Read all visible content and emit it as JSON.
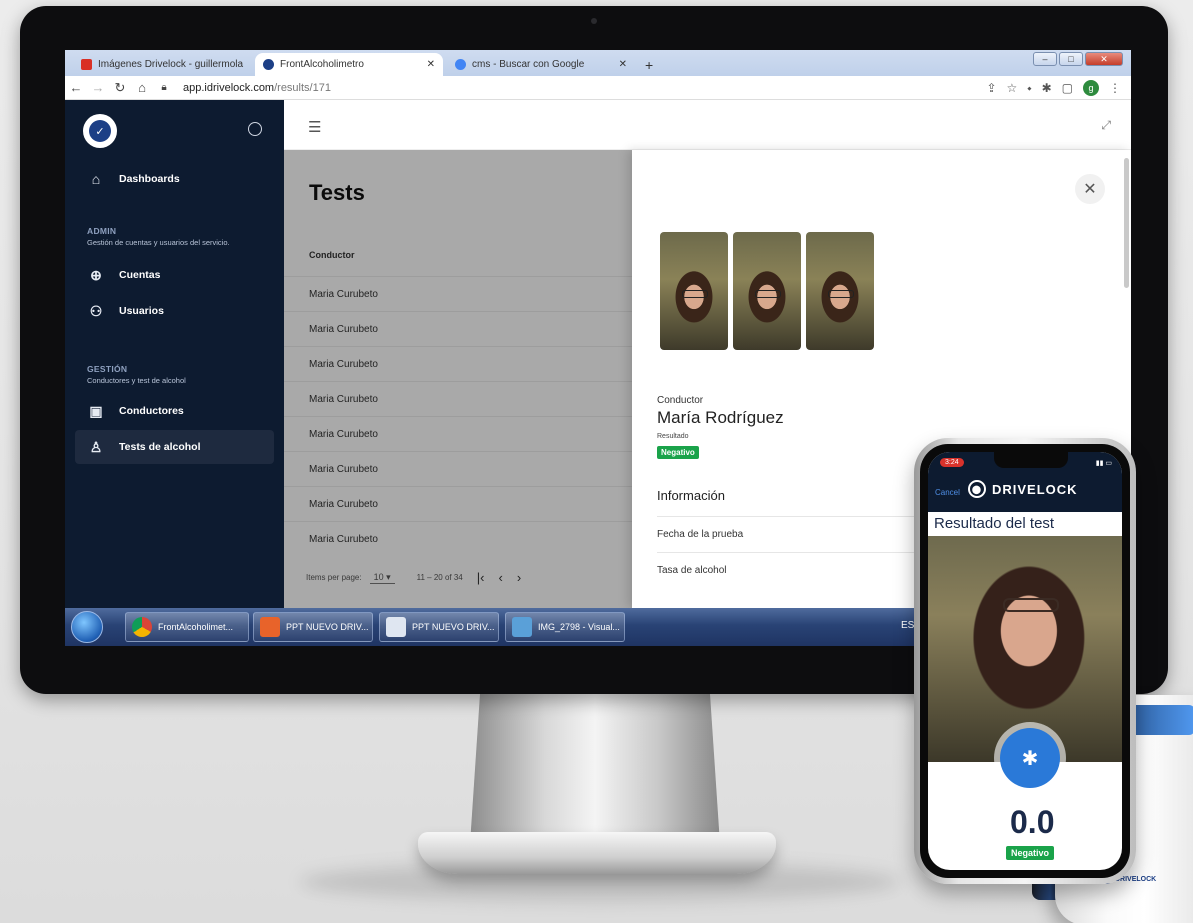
{
  "browser": {
    "tabs": [
      {
        "label": "Imágenes Drivelock - guillermola",
        "favicon_color": "#d93025"
      },
      {
        "label": "FrontAlcoholimetro",
        "favicon_color": "#1c3f86"
      },
      {
        "label": "cms - Buscar con Google",
        "favicon_color": "#4285f4"
      }
    ],
    "url_host": "app.idrivelock.com",
    "url_path": "/results/171",
    "profile_initial": "g"
  },
  "sidebar": {
    "dashboards": "Dashboards",
    "admin_title": "ADMIN",
    "admin_subtitle": "Gestión de cuentas y usuarios del servicio.",
    "cuentas": "Cuentas",
    "usuarios": "Usuarios",
    "gestion_title": "GESTIÓN",
    "gestion_subtitle": "Conductores y test de alcohol",
    "conductores": "Conductores",
    "tests": "Tests de alcohol"
  },
  "main": {
    "title": "Tests",
    "column_header": "Conductor",
    "rows": [
      "Maria Curubeto",
      "Maria Curubeto",
      "Maria Curubeto",
      "Maria Curubeto",
      "Maria Curubeto",
      "Maria Curubeto",
      "Maria Curubeto",
      "Maria Curubeto"
    ],
    "pager": {
      "items_label": "Items per page:",
      "page_size": "10",
      "range": "11 – 20 of 34"
    }
  },
  "panel": {
    "conductor_label": "Conductor",
    "conductor_name": "María Rodríguez",
    "resultado_label": "Resultado",
    "resultado_value": "Negativo",
    "info_title": "Información",
    "fecha_label": "Fecha de la prueba",
    "tasa_label": "Tasa de alcohol"
  },
  "taskbar": {
    "items": [
      "FrontAlcoholimet...",
      "PPT NUEVO DRIV...",
      "PPT NUEVO DRIV...",
      "IMG_2798 - Visual..."
    ],
    "lang": "ES"
  },
  "phone": {
    "time": "3:24",
    "cancel": "Cancel",
    "brand": "DRIVELOCK",
    "title": "Resultado del test",
    "value": "0.0",
    "result": "Negativo"
  },
  "device": {
    "brand": "DRIVELOCK"
  },
  "colors": {
    "sidebar_bg": "#0d1b30",
    "badge_green": "#1aa34a",
    "brand_blue": "#1c3f86"
  }
}
